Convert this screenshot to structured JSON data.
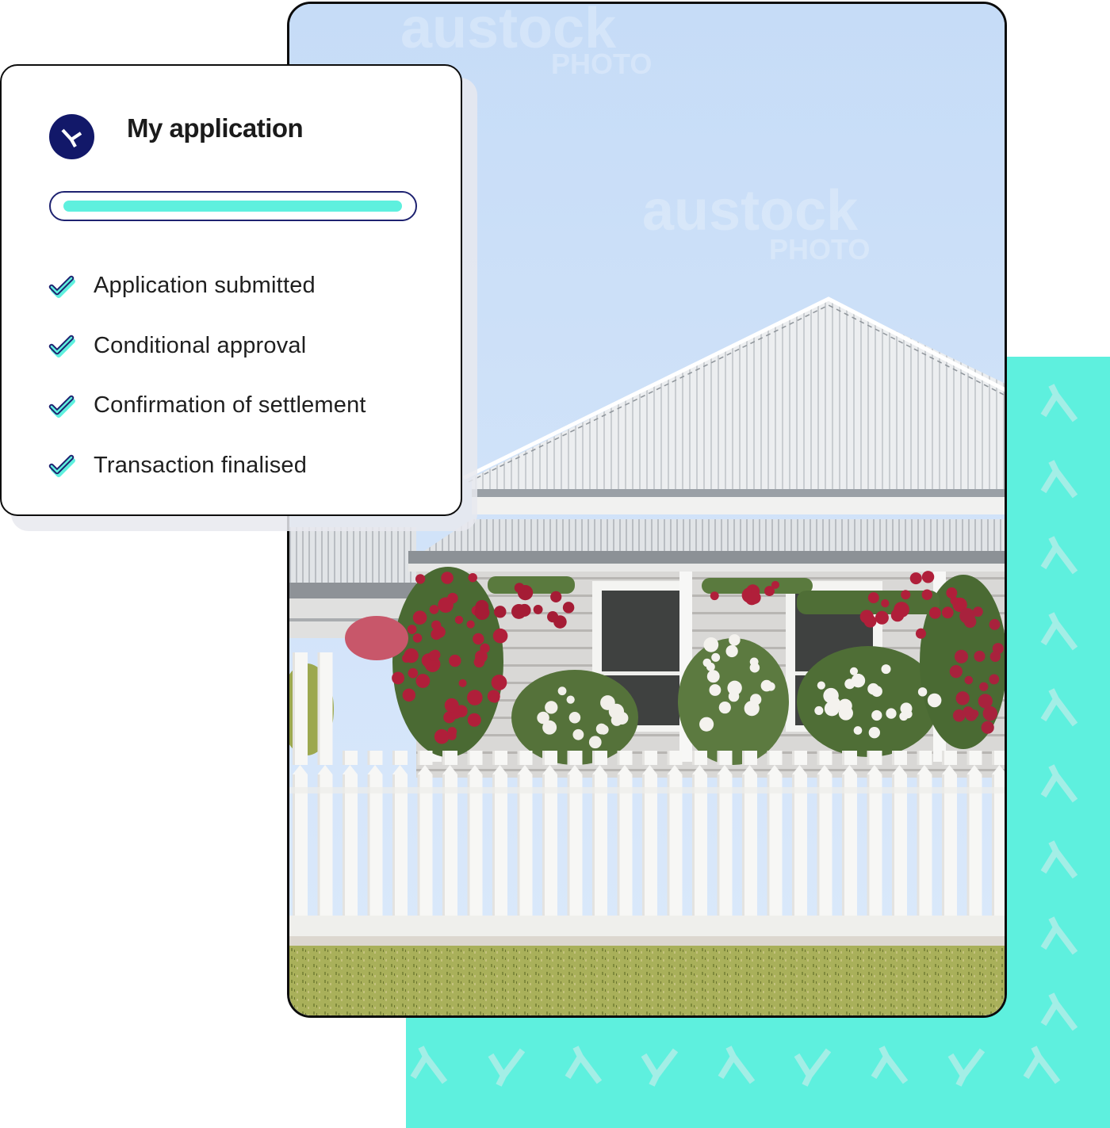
{
  "card": {
    "title": "My application",
    "brand_icon": "brand-y-logo-icon",
    "progress": {
      "value": 100,
      "unit": "percent"
    },
    "steps": [
      {
        "label": "Application submitted",
        "status": "complete",
        "icon": "check-icon"
      },
      {
        "label": "Conditional approval",
        "status": "complete",
        "icon": "check-icon"
      },
      {
        "label": "Confirmation of settlement",
        "status": "complete",
        "icon": "check-icon"
      },
      {
        "label": "Transaction finalised",
        "status": "complete",
        "icon": "check-icon"
      }
    ]
  },
  "photo": {
    "subject": "white weatherboard house with picket fence and roses",
    "watermark_text": "austock",
    "watermark_subtext": "PHOTO"
  },
  "colors": {
    "accent_teal": "#5ef0de",
    "brand_navy": "#121869",
    "progress_border": "#1e2270",
    "text": "#1f1f1f"
  }
}
